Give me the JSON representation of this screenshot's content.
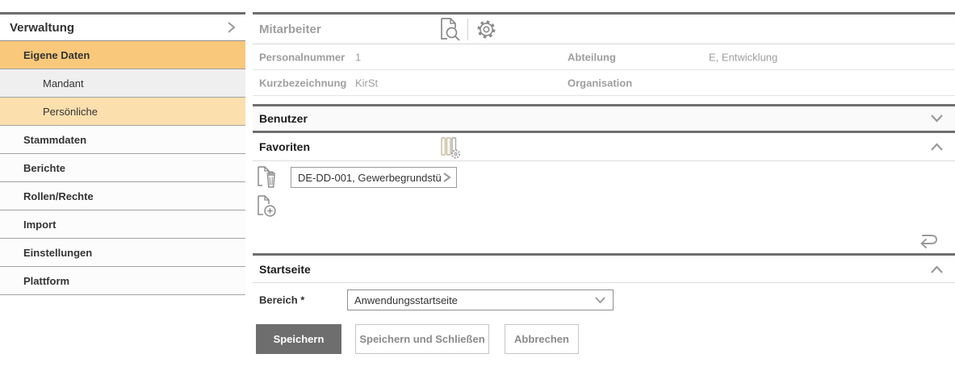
{
  "colors": {
    "sidebar_selected": "#F9C87B",
    "sidebar_sub_selected": "#FBDFAD",
    "sidebar_sub_gray": "#EFEFEF",
    "primary_button": "#6E6E6E",
    "section_rule": "#6F6F6F",
    "muted_text": "#9E9E9E",
    "icon_gray": "#8A8A8A"
  },
  "icons": {
    "preview": "document-search-icon",
    "settings": "gear-icon",
    "favorites_manage": "archive-gear-icon",
    "delete_favorite": "document-trash-icon",
    "add_favorite": "document-plus-icon",
    "reset": "undo-arrow-icon",
    "collapse": "chevron-up-icon",
    "expand": "chevron-down-icon",
    "drilldown": "chevron-right-icon"
  },
  "sidebar": {
    "header": {
      "label": "Verwaltung"
    },
    "items": [
      {
        "label": "Eigene Daten"
      },
      {
        "label": "Mandant"
      },
      {
        "label": "Persönliche"
      },
      {
        "label": "Stammdaten"
      },
      {
        "label": "Berichte"
      },
      {
        "label": "Rollen/Rechte"
      },
      {
        "label": "Import"
      },
      {
        "label": "Einstellungen"
      },
      {
        "label": "Plattform"
      }
    ]
  },
  "main": {
    "title": "Mitarbeiter",
    "fields": {
      "personalnummer": {
        "label": "Personalnummer",
        "value": "1"
      },
      "kurzbezeichnung": {
        "label": "Kurzbezeichnung",
        "value": "KirSt"
      },
      "abteilung": {
        "label": "Abteilung",
        "value": "E, Entwicklung"
      },
      "organisation": {
        "label": "Organisation",
        "value": ""
      }
    },
    "sections": {
      "benutzer": {
        "title": "Benutzer"
      },
      "favoriten": {
        "title": "Favoriten",
        "favorite_item": "DE-DD-001, Gewerbegrundstü"
      },
      "startseite": {
        "title": "Startseite",
        "bereich_label": "Bereich *",
        "bereich_value": "Anwendungsstartseite"
      }
    },
    "buttons": {
      "save": "Speichern",
      "save_close": "Speichern und Schließen",
      "cancel": "Abbrechen"
    }
  }
}
